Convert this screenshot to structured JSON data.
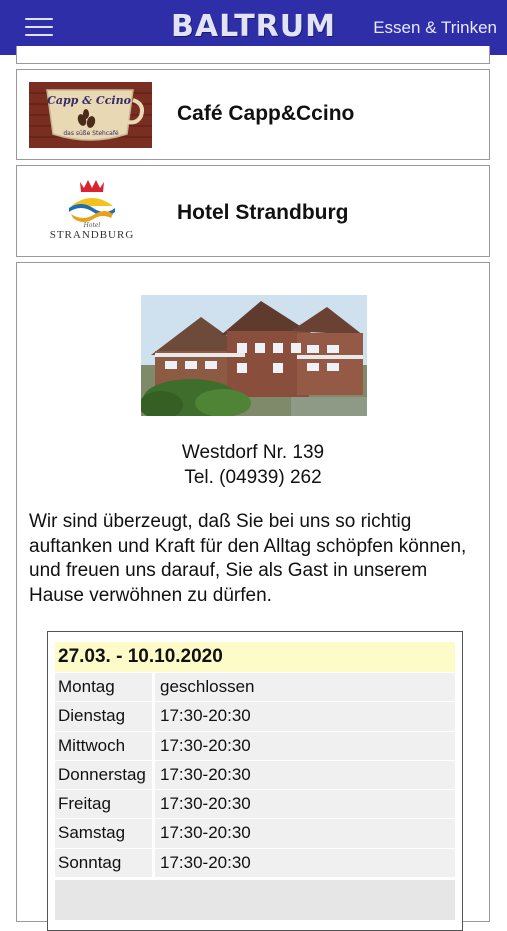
{
  "header": {
    "brand": "BALTRUM",
    "section_link": "Essen & Trinken"
  },
  "listing": [
    {
      "title": "Café Capp&Ccino",
      "logo_text_top": "Capp & Ccino",
      "logo_text_bottom": "das süße Stehcafé"
    },
    {
      "title": "Hotel Strandburg",
      "logo_text_small": "Hotel",
      "logo_text": "STRANDBURG"
    }
  ],
  "detail": {
    "address_line1": "Westdorf Nr. 139",
    "address_line2": "Tel. (04939) 262",
    "description": "Wir sind überzeugt, daß Sie bei uns so richtig auftanken und Kraft für den Alltag schöpfen können, und freuen uns darauf, Sie als Gast in unserem Hause verwöhnen zu dürfen.",
    "hours": {
      "period": "27.03. - 10.10.2020",
      "rows": [
        {
          "day": "Montag",
          "time": "geschlossen"
        },
        {
          "day": "Dienstag",
          "time": "17:30-20:30"
        },
        {
          "day": "Mittwoch",
          "time": "17:30-20:30"
        },
        {
          "day": "Donnerstag",
          "time": "17:30-20:30"
        },
        {
          "day": "Freitag",
          "time": "17:30-20:30"
        },
        {
          "day": "Samstag",
          "time": "17:30-20:30"
        },
        {
          "day": "Sonntag",
          "time": "17:30-20:30"
        }
      ]
    }
  },
  "colors": {
    "header_bg": "#2e2fa8",
    "period_bg": "#fdfbc7",
    "row_bg": "#f0f0f0"
  }
}
